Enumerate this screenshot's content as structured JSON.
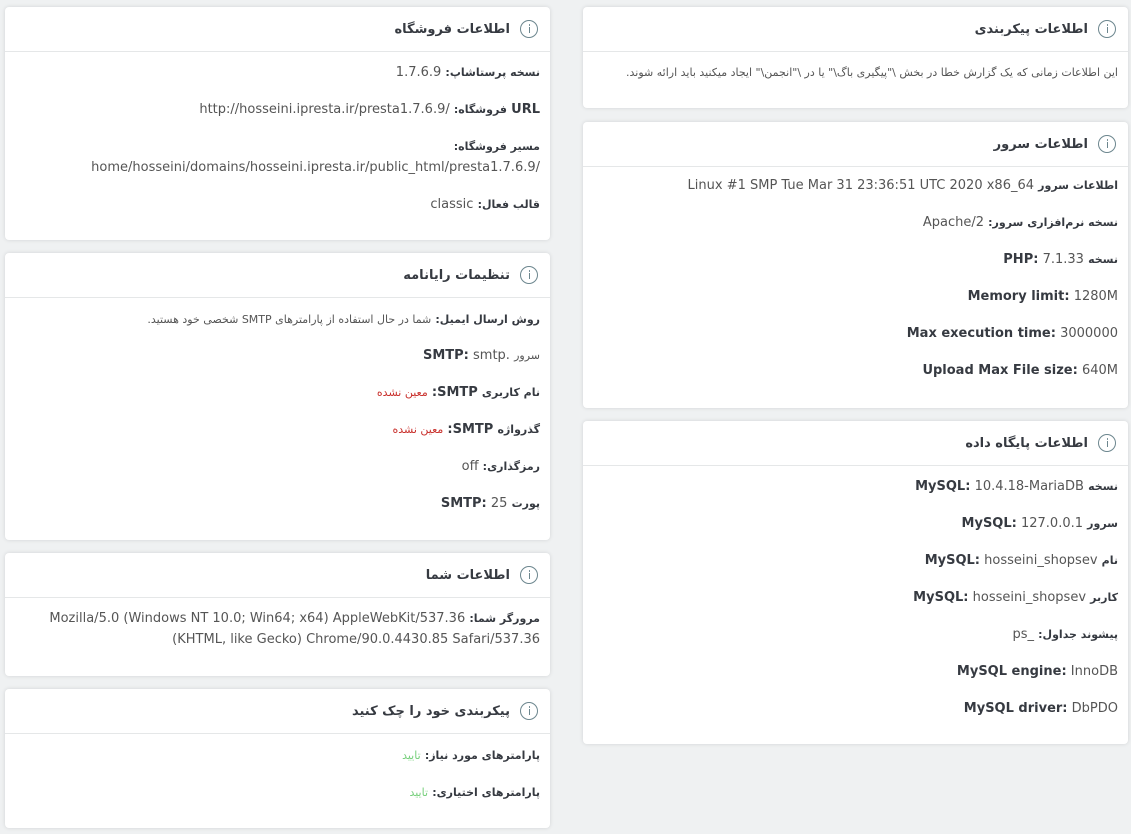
{
  "shop": {
    "title": "اطلاعات فروشگاه",
    "version_label": "نسخه پرستاشاپ:",
    "version_value": "1.7.6.9",
    "url_label_en": "URL",
    "url_label": "فروشگاه:",
    "url_value": "http://hosseini.ipresta.ir/presta1.7.6.9/",
    "path_label": "مسیر فروشگاه:",
    "path_value": "home/hosseini/domains/hosseini.ipresta.ir/public_html/presta1.7.6.9/",
    "theme_label": "قالب فعال:",
    "theme_value": "classic"
  },
  "mail": {
    "title": "تنظیمات رایانامه",
    "method_label": "روش ارسال ایمیل:",
    "method_value": "شما در حال استفاده از پارامترهای SMTP شخصی خود هستید.",
    "server_label": "سرور",
    "server_label_en": "SMTP:",
    "server_value": "smtp.",
    "user_label": "نام کاربری",
    "user_label_en": "SMTP:",
    "user_value": "معین نشده",
    "pass_label": "گذرواژه",
    "pass_label_en": "SMTP:",
    "pass_value": "معین نشده",
    "enc_label": "رمزگذاری:",
    "enc_value": "off",
    "port_label": "پورت",
    "port_label_en": "SMTP:",
    "port_value": "25"
  },
  "you": {
    "title": "اطلاعات شما",
    "browser_label": "مرورگر شما:",
    "browser_line1": "Mozilla/5.0 (Windows NT 10.0; Win64; x64) AppleWebKit/537.36",
    "browser_line2": "(KHTML, like Gecko) Chrome/90.0.4430.85 Safari/537.36"
  },
  "check": {
    "title": "پیکربندی خود را چک کنید",
    "required_label": "پارامترهای مورد نیاز:",
    "required_value": "تایید",
    "optional_label": "پارامترهای اختیاری:",
    "optional_value": "تایید"
  },
  "config": {
    "title": "اطلاعات پیکربندی",
    "text": "این اطلاعات زمانی که یک گزارش خطا در بخش \\\"پیگیری باگ\\\" یا در \\\"انجمن\\\" ایجاد میکنید باید ارائه شوند."
  },
  "server": {
    "title": "اطلاعات سرور",
    "info_label": "اطلاعات سرور",
    "info_value": "Linux #1 SMP Tue Mar 31 23:36:51 UTC 2020 x86_64",
    "software_label": "نسخه نرم‌افزاری سرور:",
    "software_value": "Apache/2",
    "php_label": "نسخه",
    "php_label_en": "PHP:",
    "php_value": "7.1.33",
    "memory_label": "Memory limit:",
    "memory_value": "1280M",
    "exec_label": "Max execution time:",
    "exec_value": "3000000",
    "upload_label": "Upload Max File size:",
    "upload_value": "640M"
  },
  "db": {
    "title": "اطلاعات پایگاه داده",
    "version_label": "نسخه",
    "version_label_en": "MySQL:",
    "version_value": "10.4.18-MariaDB",
    "server_label": "سرور",
    "server_label_en": "MySQL:",
    "server_value": "127.0.0.1",
    "name_label": "نام",
    "name_label_en": "MySQL:",
    "name_value": "hosseini_shopsev",
    "user_label": "کاربر",
    "user_label_en": "MySQL:",
    "user_value": "hosseini_shopsev",
    "prefix_label": "پیشوند جداول:",
    "prefix_value": "ps_",
    "engine_label": "MySQL engine:",
    "engine_value": "InnoDB",
    "driver_label": "MySQL driver:",
    "driver_value": "DbPDO"
  }
}
